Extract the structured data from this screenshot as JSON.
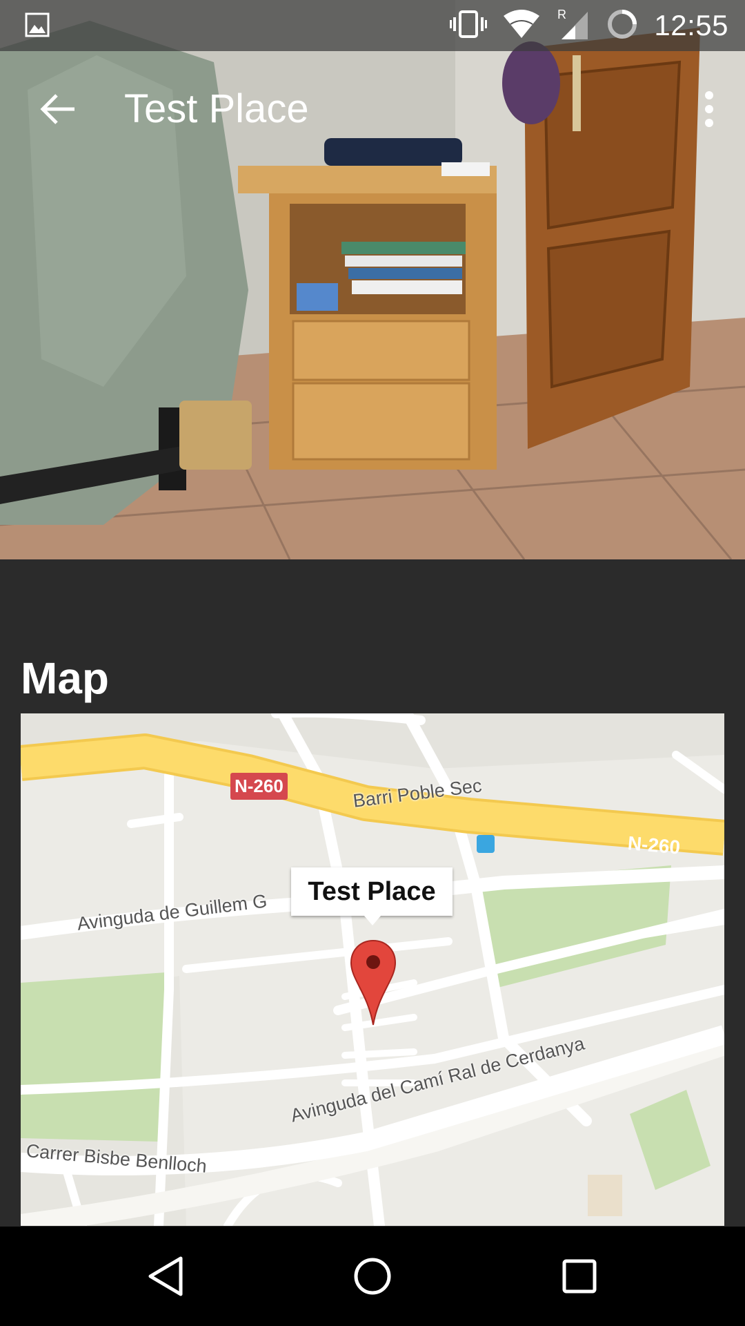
{
  "status_bar": {
    "time": "12:55",
    "icons": [
      "image-notification-icon",
      "vibrate-icon",
      "wifi-icon",
      "roaming-signal-icon",
      "battery-loading-icon"
    ]
  },
  "toolbar": {
    "title": "Test Place",
    "back_icon": "arrow-back-icon",
    "overflow_icon": "more-vert-icon"
  },
  "map_section": {
    "title": "Map",
    "marker_title": "Test Place",
    "road_shield": "N-260",
    "highway_label": "N-260",
    "street_labels": [
      "Barri Poble Sec",
      "Avinguda de Guillem G",
      "Avinguda del Camí Ral de Cerdanya",
      "Carrer Bisbe Benlloch"
    ]
  },
  "nav_bar": {
    "buttons": [
      "back-triangle-icon",
      "home-circle-icon",
      "recents-square-icon"
    ]
  },
  "colors": {
    "background": "#2b2b2b",
    "highway": "#fddb6b",
    "park": "#c8dfb0",
    "shield": "#d5484e",
    "marker": "#e2463c"
  }
}
